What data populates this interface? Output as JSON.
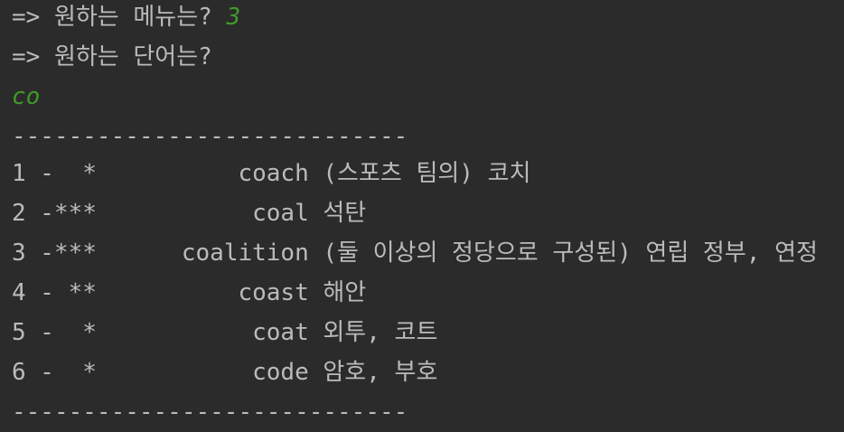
{
  "console": {
    "prompt_menu": "=> 원하는 메뉴는? ",
    "menu_input": "3",
    "prompt_word": "=> 원하는 단어는?",
    "word_input": "co",
    "separator": "----------------------------",
    "results": [
      {
        "num": "1",
        "stars": "*",
        "word": "coach",
        "meaning": "(스포츠 팀의) 코치"
      },
      {
        "num": "2",
        "stars": "***",
        "word": "coal",
        "meaning": "석탄"
      },
      {
        "num": "3",
        "stars": "***",
        "word": "coalition",
        "meaning": "(둘 이상의 정당으로 구성된) 연립 정부, 연정"
      },
      {
        "num": "4",
        "stars": "**",
        "word": "coast",
        "meaning": "해안"
      },
      {
        "num": "5",
        "stars": "*",
        "word": "coat",
        "meaning": "외투, 코트"
      },
      {
        "num": "6",
        "stars": "*",
        "word": "code",
        "meaning": "암호, 부호"
      }
    ],
    "colors": {
      "text": "#bbbbbb",
      "input": "#3f9a2a",
      "background": "#2b2b2b"
    }
  }
}
